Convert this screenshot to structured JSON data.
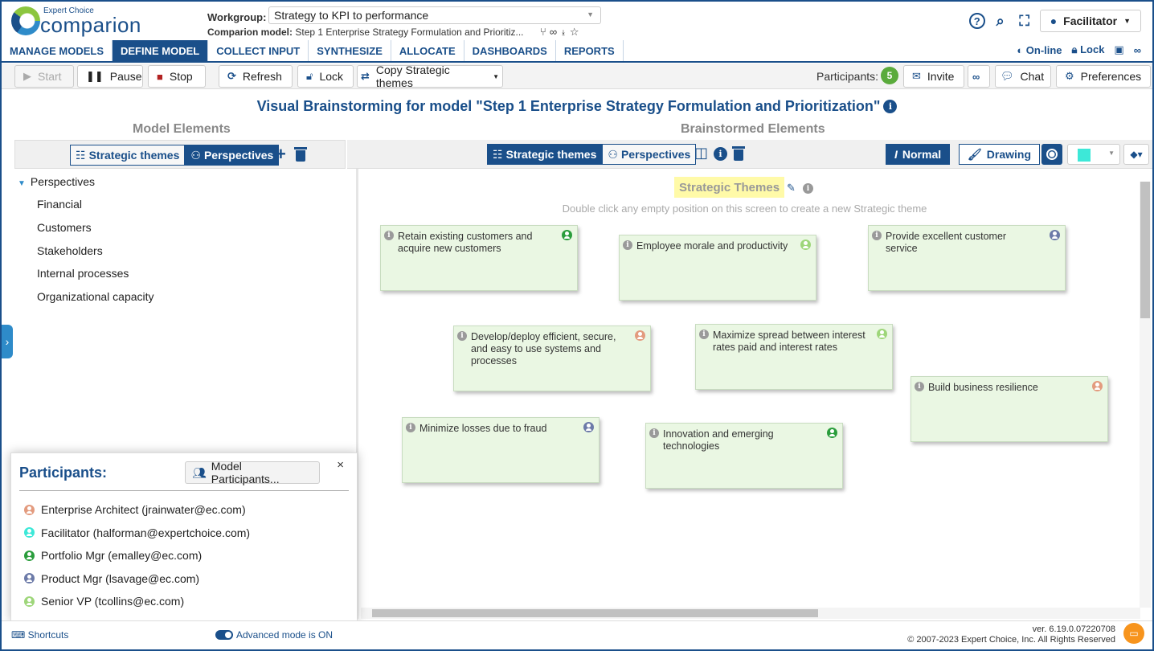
{
  "header": {
    "logo_small": "Expert Choice",
    "logo_big": "comparion",
    "workgroup_label": "Workgroup:",
    "workgroup_value": "Strategy to KPI to performance",
    "model_label": "Comparion model:",
    "model_value": "Step 1 Enterprise Strategy Formulation and Prioritiz...",
    "user_button": "Facilitator"
  },
  "nav": {
    "items": [
      "MANAGE MODELS",
      "DEFINE MODEL",
      "COLLECT INPUT",
      "SYNTHESIZE",
      "ALLOCATE",
      "DASHBOARDS",
      "REPORTS"
    ],
    "online": "On-line",
    "lock": "Lock"
  },
  "toolbar": {
    "start": "Start",
    "pause": "Pause",
    "stop": "Stop",
    "refresh": "Refresh",
    "lock": "Lock",
    "copy": "Copy Strategic themes",
    "participants_label": "Participants:",
    "participants_count": "5",
    "invite": "Invite",
    "chat": "Chat",
    "preferences": "Preferences"
  },
  "page_title": "Visual Brainstorming for model \"Step 1 Enterprise Strategy Formulation and Prioritization\"",
  "left": {
    "title": "Model Elements",
    "tab_strategic": "Strategic themes",
    "tab_perspectives": "Perspectives",
    "tree_root": "Perspectives",
    "tree_items": [
      "Financial",
      "Customers",
      "Stakeholders",
      "Internal processes",
      "Organizational capacity"
    ]
  },
  "right": {
    "title": "Brainstormed Elements",
    "tab_strategic": "Strategic themes",
    "tab_perspectives": "Perspectives",
    "mode_normal": "Normal",
    "mode_drawing": "Drawing",
    "pen_color": "#3de8d8"
  },
  "canvas": {
    "title": "Strategic Themes",
    "hint": "Double click any empty position on this screen to create a new Strategic theme",
    "notes": [
      {
        "text": "Retain existing customers and acquire new customers",
        "user_color": "#2a9d3c"
      },
      {
        "text": "Employee morale and productivity",
        "user_color": "#9ed67a"
      },
      {
        "text": "Provide excellent customer service",
        "user_color": "#6c7aa8"
      },
      {
        "text": "Develop/deploy efficient, secure, and easy to use systems and processes",
        "user_color": "#e39b7e"
      },
      {
        "text": "Maximize spread between interest rates paid and interest rates",
        "user_color": "#9ed67a"
      },
      {
        "text": "Build business resilience",
        "user_color": "#e39b7e"
      },
      {
        "text": "Minimize losses due to fraud",
        "user_color": "#6c7aa8"
      },
      {
        "text": "Innovation and emerging technologies",
        "user_color": "#2a9d3c"
      }
    ]
  },
  "participants_popup": {
    "title": "Participants:",
    "button": "Model Participants...",
    "close": "×",
    "list": [
      {
        "name": "Enterprise Architect (jrainwater@ec.com)",
        "color": "#e39b7e"
      },
      {
        "name": "Facilitator (halforman@expertchoice.com)",
        "color": "#3de8d8"
      },
      {
        "name": "Portfolio Mgr (emalley@ec.com)",
        "color": "#2a9d3c"
      },
      {
        "name": "Product Mgr (lsavage@ec.com)",
        "color": "#6c7aa8"
      },
      {
        "name": "Senior VP (tcollins@ec.com)",
        "color": "#9ed67a"
      }
    ]
  },
  "footer": {
    "shortcuts": "Shortcuts",
    "advanced": "Advanced mode is ON",
    "version": "ver. 6.19.0.07220708",
    "copyright": "© 2007-2023 Expert Choice, Inc. All Rights Reserved"
  }
}
